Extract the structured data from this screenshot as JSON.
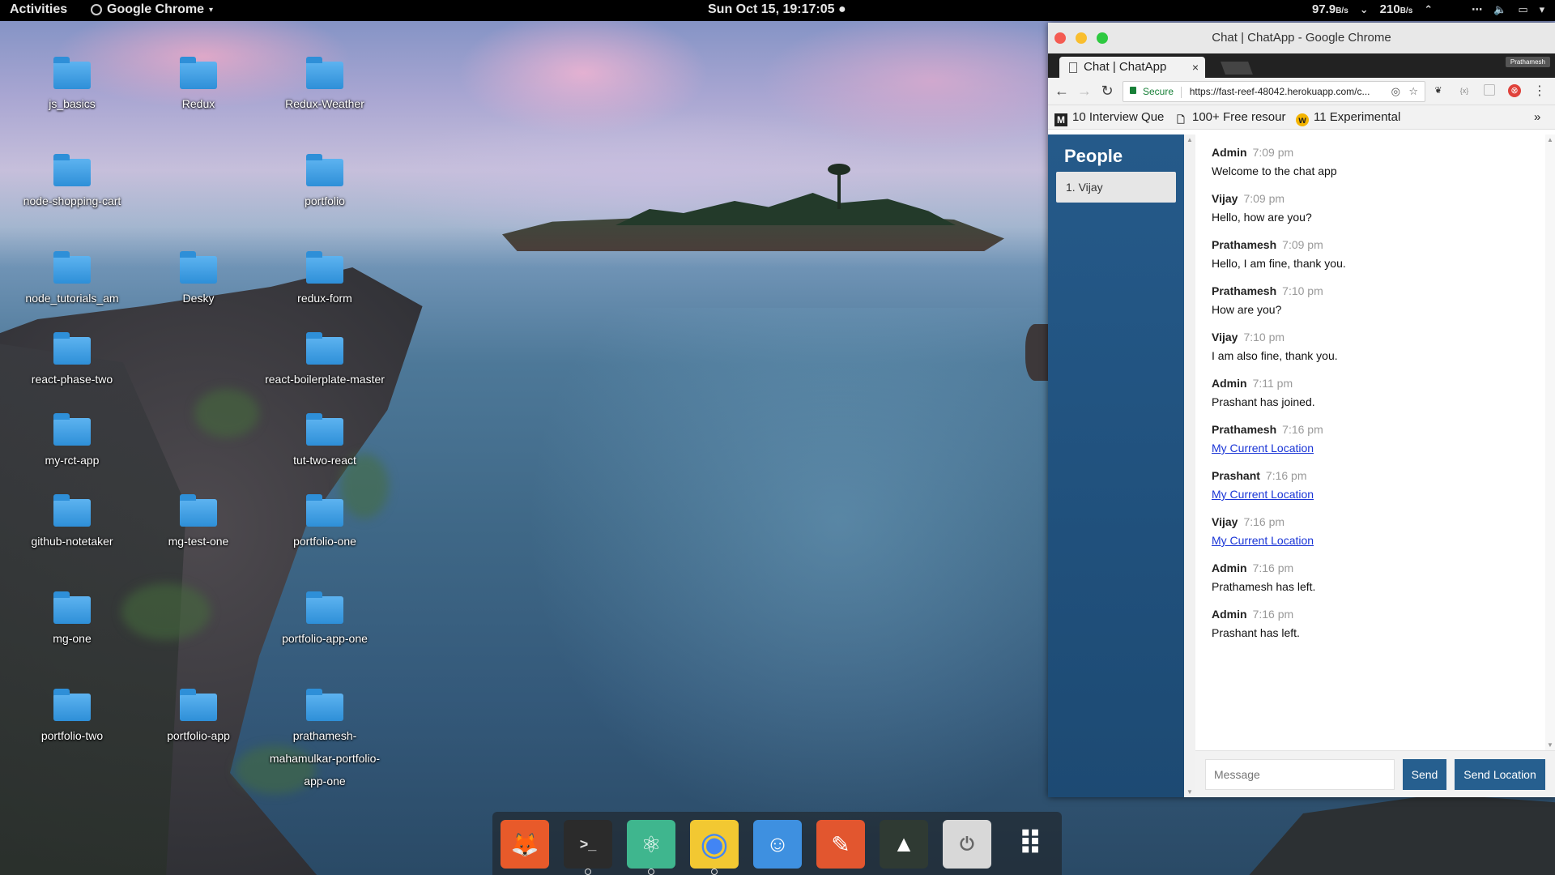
{
  "topbar": {
    "activities": "Activities",
    "app_name": "Google Chrome",
    "clock": "Sun Oct 15, 19:17:05",
    "net_down": "97.9",
    "net_down_unit": "B/s",
    "net_up": "210",
    "net_up_unit": "B/s"
  },
  "desktop": {
    "icons": [
      {
        "label": "js_basics"
      },
      {
        "label": "Redux"
      },
      {
        "label": "Redux-Weather"
      },
      {
        "label": "node-shopping-cart"
      },
      {
        "label": "portfolio"
      },
      {
        "label": "node_tutorials_am"
      },
      {
        "label": "Desky"
      },
      {
        "label": "redux-form"
      },
      {
        "label": "react-phase-two"
      },
      {
        "label": "react-boilerplate-master"
      },
      {
        "label": "my-rct-app"
      },
      {
        "label": "tut-two-react"
      },
      {
        "label": "github-notetaker"
      },
      {
        "label": "mg-test-one"
      },
      {
        "label": "portfolio-one"
      },
      {
        "label": "mg-one"
      },
      {
        "label": "portfolio-app-one"
      },
      {
        "label": "portfolio-two"
      },
      {
        "label": "portfolio-app"
      },
      {
        "label": "prathamesh-mahamulkar-portfolio-app-one"
      }
    ]
  },
  "browser": {
    "window_title": "Chat | ChatApp - Google Chrome",
    "tab_title": "Chat | ChatApp",
    "profile": "Prathamesh",
    "secure_label": "Secure",
    "url": "https://fast-reef-48042.herokuapp.com/c...",
    "bookmarks": [
      {
        "label": "10 Interview Que",
        "icon": "M"
      },
      {
        "label": "100+ Free resour",
        "icon": "doc"
      },
      {
        "label": "11 Experimental",
        "icon": "w"
      }
    ],
    "bookmarks_more": "»"
  },
  "chat": {
    "people_title": "People",
    "people": [
      "1. Vijay"
    ],
    "messages": [
      {
        "from": "Admin",
        "time": "7:09 pm",
        "text": "Welcome to the chat app",
        "link": false
      },
      {
        "from": "Vijay",
        "time": "7:09 pm",
        "text": "Hello, how are you?",
        "link": false
      },
      {
        "from": "Prathamesh",
        "time": "7:09 pm",
        "text": "Hello, I am fine, thank you.",
        "link": false
      },
      {
        "from": "Prathamesh",
        "time": "7:10 pm",
        "text": "How are you?",
        "link": false
      },
      {
        "from": "Vijay",
        "time": "7:10 pm",
        "text": "I am also fine, thank you.",
        "link": false
      },
      {
        "from": "Admin",
        "time": "7:11 pm",
        "text": "Prashant has joined.",
        "link": false
      },
      {
        "from": "Prathamesh",
        "time": "7:16 pm",
        "text": "My Current Location",
        "link": true
      },
      {
        "from": "Prashant",
        "time": "7:16 pm",
        "text": "My Current Location",
        "link": true
      },
      {
        "from": "Vijay",
        "time": "7:16 pm",
        "text": "My Current Location",
        "link": true
      },
      {
        "from": "Admin",
        "time": "7:16 pm",
        "text": "Prathamesh has left.",
        "link": false
      },
      {
        "from": "Admin",
        "time": "7:16 pm",
        "text": "Prashant has left.",
        "link": false
      }
    ],
    "input_placeholder": "Message",
    "send_label": "Send",
    "send_location_label": "Send Location"
  },
  "dock": {
    "apps": [
      {
        "icon": "gimp-icon",
        "bg": "#e85a2a"
      },
      {
        "icon": "terminal-icon",
        "bg": "#2b2b2b"
      },
      {
        "icon": "atom-icon",
        "bg": "#3fb68e"
      },
      {
        "icon": "chrome-icon",
        "bg": "#f2c832"
      },
      {
        "icon": "finder-icon",
        "bg": "#3e90e0"
      },
      {
        "icon": "scratch-icon",
        "bg": "#e2562f"
      },
      {
        "icon": "system-monitor-icon",
        "bg": "#2f3a33"
      },
      {
        "icon": "power-icon",
        "bg": "#d8d8d8"
      },
      {
        "icon": "app-grid-icon",
        "bg": "transparent"
      }
    ]
  }
}
